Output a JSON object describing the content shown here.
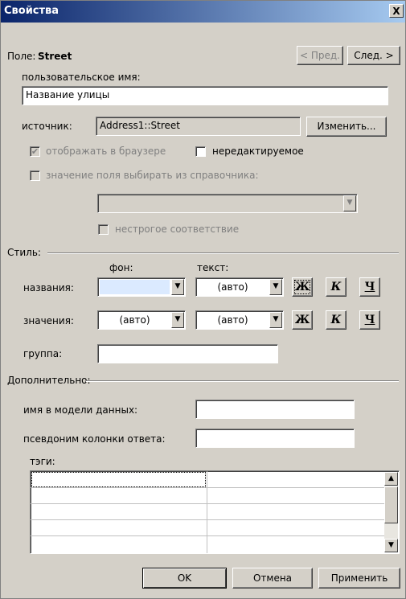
{
  "window": {
    "title": "Свойства",
    "close_glyph": "X"
  },
  "field": {
    "label": "Поле:",
    "name": "Street",
    "prev_label": "< Пред.",
    "next_label": "След. >"
  },
  "user_name": {
    "label": "пользовательское имя:",
    "value": "Название улицы"
  },
  "source": {
    "label": "источник:",
    "value": "Address1::Street",
    "change_label": "Изменить..."
  },
  "options": {
    "show_in_browser": {
      "label": "отображать в браузере",
      "checked": true,
      "disabled": true
    },
    "readonly": {
      "label": "нередактируемое",
      "checked": false,
      "disabled": false
    },
    "from_dictionary": {
      "label": "значение поля выбирать из справочника:",
      "checked": false,
      "disabled": true
    },
    "dictionary_value": "",
    "non_strict": {
      "label": "нестрогое соответствие",
      "checked": false,
      "disabled": true
    }
  },
  "style": {
    "section_label": "Стиль:",
    "bg_header": "фон:",
    "text_header": "текст:",
    "names": {
      "label": "названия:",
      "bg": "",
      "bg_color": "#dbeaff",
      "text": "(авто)"
    },
    "values": {
      "label": "значения:",
      "bg": "(авто)",
      "text": "(авто)"
    },
    "bold_glyph": "Ж",
    "italic_glyph": "К",
    "underline_glyph": "Ч",
    "group_label": "группа:",
    "group_value": ""
  },
  "additional": {
    "section_label": "Дополнительно:",
    "model_name_label": "имя в модели данных:",
    "model_name_value": "",
    "alias_label": "псевдоним колонки ответа:",
    "alias_value": "",
    "tags_label": "тэги:"
  },
  "buttons": {
    "ok": "OK",
    "cancel": "Отмена",
    "apply": "Применить"
  }
}
